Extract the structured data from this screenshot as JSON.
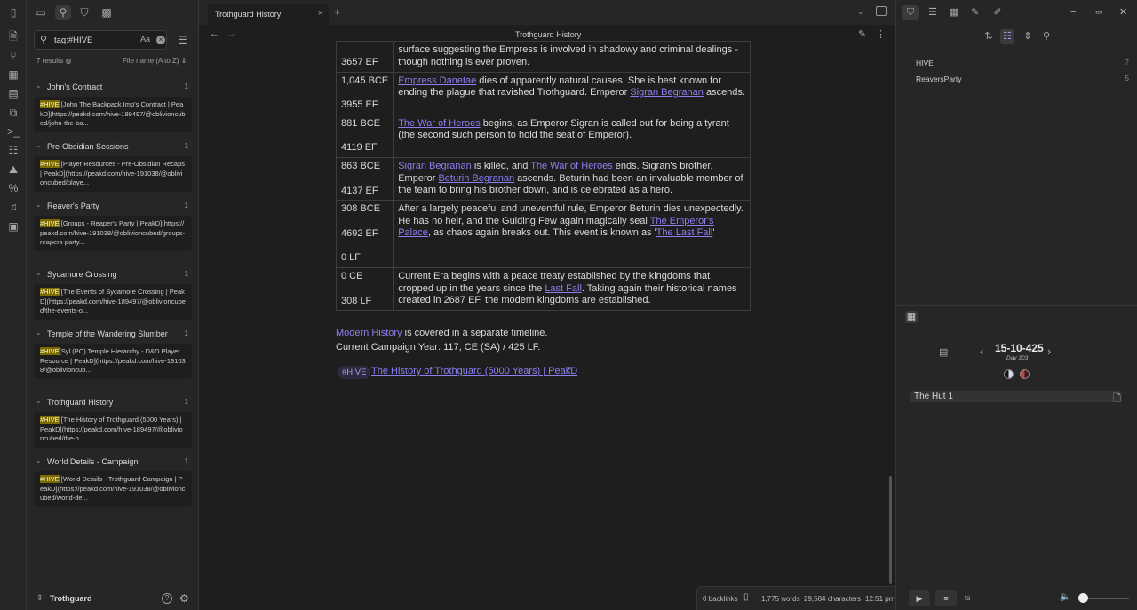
{
  "ribbon": {
    "icons": [
      "files-icon",
      "git-icon",
      "blocks-icon",
      "calendar-icon",
      "copy-icon",
      "terminal-icon",
      "table-icon",
      "map-icon",
      "percent-code-icon",
      "music-icon",
      "calendar-clock-icon"
    ]
  },
  "sidebar": {
    "search": {
      "value": "tag:#HIVE",
      "case_label": "Aa"
    },
    "results_label": "7 results",
    "sort_label": "File name (A to Z)",
    "groups": [
      {
        "name": "John's Contract",
        "count": "1",
        "tag": "#HIVE",
        "snippet": " [John The Backpack Imp's Contract | PeakD](https://peakd.com/hive-189497/@oblivioncubed/john-the-ba..."
      },
      {
        "name": "Pre-Obsidian Sessions",
        "count": "1",
        "tag": "#HIVE",
        "snippet": " [Player Resources - Pre-Obsidian Recaps | PeakD](https://peakd.com/hive-191038/@oblivioncubed/playe..."
      },
      {
        "name": "Reaver's Party",
        "count": "1",
        "tag": "#HIVE",
        "snippet": " [Groups - Reaper's Party | PeakD](https://peakd.com/hive-191038/@oblivioncubed/groups-reapers-party..."
      },
      {
        "name": "Sycamore Crossing",
        "count": "1",
        "tag": "#HIVE",
        "snippet": " [The Events of Sycamore Crossing | PeakD](https://peakd.com/hive-189497/@oblivioncubed/the-events-o..."
      },
      {
        "name": "Temple of the Wandering Slumber",
        "count": "1",
        "tag": "#HIVE",
        "snippet": "[Syl (PC) Temple Hierarchy - D&D Player Resource | PeakD](https://peakd.com/hive-191038/@oblivioncub..."
      },
      {
        "name": "Trothguard History",
        "count": "1",
        "tag": "#HIVE",
        "snippet": " [The History of Trothguard (5000 Years) | PeakD](https://peakd.com/hive-189497/@oblivioncubed/the-h..."
      },
      {
        "name": "World Details - Campaign",
        "count": "1",
        "tag": "#HIVE",
        "snippet": " [World Details - Trothguard Campaign | PeakD](https://peakd.com/hive-191038/@oblivioncubed/world-de..."
      }
    ],
    "vault_name": "Trothguard"
  },
  "main": {
    "tab_title": "Trothguard History",
    "note_title": "Trothguard History",
    "rows": [
      {
        "d1": "",
        "d2": "3657 EF",
        "text": [
          [
            "t",
            "surface suggesting the Empress is involved in shadowy and criminal dealings - though nothing is ever proven."
          ]
        ]
      },
      {
        "d1": "1,045 BCE",
        "d2": "3955 EF",
        "text": [
          [
            "l",
            "Empress Danetae"
          ],
          [
            "t",
            " dies of apparently natural causes. She is best known for ending the plague that ravished Trothguard. Emperor "
          ],
          [
            "l",
            "Sigran Begranan"
          ],
          [
            "t",
            " ascends."
          ]
        ]
      },
      {
        "d1": "881 BCE",
        "d2": "4119 EF",
        "text": [
          [
            "l",
            "The War of Heroes"
          ],
          [
            "t",
            " begins, as Emperor Sigran is called out for being a tyrant (the second such person to hold the seat of Emperor)."
          ]
        ]
      },
      {
        "d1": "863 BCE",
        "d2": "4137 EF",
        "text": [
          [
            "l",
            "Sigran Begranan"
          ],
          [
            "t",
            " is killed, and "
          ],
          [
            "l",
            "The War of Heroes"
          ],
          [
            "t",
            " ends. Sigran's brother, Emperor "
          ],
          [
            "l",
            "Beturin Begranan"
          ],
          [
            "t",
            " ascends. Beturin had been an invaluable member of the team to bring his brother down, and is celebrated as a hero."
          ]
        ]
      },
      {
        "d1": "308 BCE",
        "d2": "4692 EF",
        "d3": "0 LF",
        "text": [
          [
            "t",
            "After a largely peaceful and uneventful rule, Emperor Beturin dies unexpectedly. He has no heir, and the Guiding Few again magically seal "
          ],
          [
            "l",
            "The Emperor's Palace"
          ],
          [
            "t",
            ", as chaos again breaks out. This event is known as '"
          ],
          [
            "l",
            "The Last Fall"
          ],
          [
            "t",
            "'"
          ]
        ]
      },
      {
        "d1": "0 CE",
        "d2": "308 LF",
        "text": [
          [
            "t",
            "Current Era begins with a peace treaty established by the kingdoms that cropped up in the years since the "
          ],
          [
            "l",
            "Last Fall"
          ],
          [
            "t",
            ". Taking again their historical names created in 2687 EF, the modern kingdoms are established."
          ]
        ]
      }
    ],
    "after_link": "Modern History",
    "after_text": " is covered in a separate timeline.",
    "campaign_year": "Current Campaign Year: 117, CE (SA) / 425 LF.",
    "tag": "#HIVE",
    "ext_link": "The History of Trothguard (5000 Years) | PeakD",
    "status": {
      "backlinks": "0 backlinks",
      "words": "1,775 words",
      "chars": "29,584 characters",
      "time": "12:51 pm"
    }
  },
  "right": {
    "tags": [
      {
        "name": "HIVE",
        "count": "7"
      },
      {
        "name": "ReaversParty",
        "count": "5"
      }
    ],
    "calendar": {
      "date": "15-10-425",
      "day": "Day 303"
    },
    "note": "The Hut 1",
    "player_label": "ts"
  }
}
